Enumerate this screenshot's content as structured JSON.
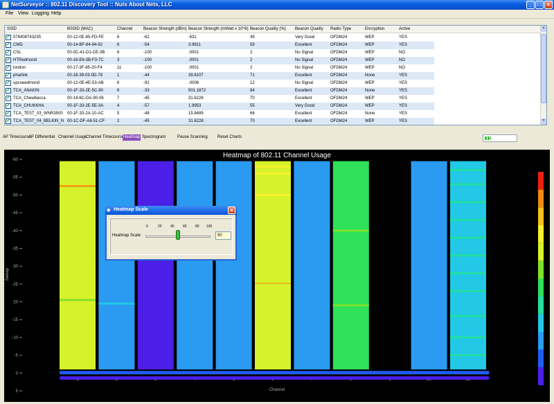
{
  "window": {
    "title": "NetSurveyor :: 802.11 Discovery Tool :: Nuts About Nets, LLC"
  },
  "menu": [
    "File",
    "View",
    "Logging",
    "Help"
  ],
  "grid": {
    "columns": [
      "SSID",
      "BSSID (MAC)",
      "Channel",
      "Beacon Strength (dBm)",
      "Beacon Strength (mWatt x 10^6)",
      "Beacon Quality (%)",
      "Beacon Quality",
      "Radio Type",
      "Encryption",
      "Active"
    ],
    "rows": [
      [
        "078408743235",
        "00-12-0E-85-FD-FE",
        "6",
        "-62",
        ".631",
        "49",
        "Very Good",
        "OFDM24",
        "WEP",
        "YES"
      ],
      [
        "CMD",
        "00-14-BF-84-94-92",
        "6",
        "-54",
        "3.9811",
        "59",
        "Excellent",
        "OFDM24",
        "WEP",
        "YES"
      ],
      [
        "CSL",
        "00-0C-41-D1-CE-3B",
        "6",
        "-100",
        ".0001",
        "2",
        "No Signal",
        "OFDM24",
        "WEP",
        "NO"
      ],
      [
        "HTRedmond",
        "00-16-E6-3B-F3-7C",
        "3",
        "-100",
        ".0001",
        "2",
        "No Signal",
        "OFDM24",
        "WEP",
        "NO"
      ],
      [
        "london",
        "00-17-3F-65-20-F4",
        "11",
        "-100",
        ".0001",
        "2",
        "No Signal",
        "OFDM24",
        "WEP",
        "NO"
      ],
      [
        "pharlink",
        "00-18-39-03-0D-78",
        "1",
        "-44",
        "39.8107",
        "71",
        "Excellent",
        "OFDM24",
        "None",
        "YES"
      ],
      [
        "upcoeedmond",
        "00-12-0E-4E-53-AB",
        "6",
        "-92",
        ".0006",
        "12",
        "No Signal",
        "OFDM24",
        "WEP",
        "YES"
      ],
      [
        "TCA_ANAKIN",
        "00-1F-33-2E-5C-90",
        "8",
        "-33",
        "501.1872",
        "84",
        "Excellent",
        "OFDM24",
        "None",
        "YES"
      ],
      [
        "TCA_Chewbacca",
        "00-14-6C-DA-90-06",
        "7",
        "-45",
        "31.6228",
        "70",
        "Excellent",
        "OFDM24",
        "WEP",
        "YES"
      ],
      [
        "TCA_CHUKKHA",
        "00-1F-33-2E-5E-3A",
        "4",
        "-57",
        "1.9953",
        "55",
        "Very Good",
        "OFDM24",
        "WEP",
        "YES"
      ],
      [
        "TCA_TEST_03_WNR3500",
        "00-1F-33-2A-10-AC",
        "5",
        "-48",
        "15.8489",
        "66",
        "Excellent",
        "OFDM24",
        "None",
        "YES"
      ],
      [
        "TCA_TEST_04_BELKIN_N",
        "00-1C-DF-A8-51-CF",
        "2",
        "-45",
        "31.6228",
        "70",
        "Excellent",
        "OFDM24",
        "WEP",
        "YES"
      ]
    ]
  },
  "toolbar": [
    "AP Timecourse",
    "AP Differential",
    "Channel Usage",
    "Channel Timecourse",
    "Heatmap",
    "Spectrogram",
    "Pause Scanning",
    "Reset Charts"
  ],
  "toolbar_active": "Heatmap",
  "progress": {
    "fraction": 0.2
  },
  "dialog": {
    "title": "Heatmap Scale",
    "label": "Heatmap Scale",
    "ticks": [
      "0",
      "20",
      "40",
      "60",
      "80",
      "100"
    ],
    "value": "50",
    "value_num": 50
  },
  "chart_data": {
    "type": "heatmap",
    "title": "Heatmap of 802.11 Channel Usage",
    "xlabel": "Channel",
    "ylabel": "Sweep",
    "x_categories": [
      "1",
      "2",
      "3",
      "4",
      "5",
      "6",
      "7",
      "8",
      "9",
      "10",
      "11"
    ],
    "y_ticks": [
      -60,
      -55,
      -50,
      -45,
      -40,
      -35,
      -30,
      -25,
      -20,
      -15,
      -10,
      -5,
      0,
      5
    ],
    "ylim": [
      5,
      -60
    ],
    "colorscale": [
      "#4b1fe6",
      "#1f5cf0",
      "#2a9bf0",
      "#22c8e6",
      "#21e0a0",
      "#2ee05a",
      "#7fe22a",
      "#d6f22a",
      "#f6f02a",
      "#f6c01a",
      "#f08a10",
      "#ee2010"
    ],
    "columns": [
      {
        "channel": "1",
        "base": "#d6f22a",
        "stripes": [
          {
            "y": -52.5,
            "color": "#f0a010"
          },
          {
            "y": -20.5,
            "color": "#7fe22a"
          }
        ]
      },
      {
        "channel": "2",
        "base": "#2a9bf0",
        "stripes": [
          {
            "y": -19.5,
            "color": "#22c8e6"
          }
        ]
      },
      {
        "channel": "3",
        "base": "#4b1fe6",
        "stripes": []
      },
      {
        "channel": "4",
        "base": "#2a9bf0",
        "stripes": []
      },
      {
        "channel": "5",
        "base": "#2a9bf0",
        "stripes": []
      },
      {
        "channel": "6",
        "base": "#d6f22a",
        "stripes": [
          {
            "y": -58,
            "color": "#f6f02a"
          },
          {
            "y": -56,
            "color": "#f6f02a"
          },
          {
            "y": -50,
            "color": "#f6f02a"
          },
          {
            "y": -25,
            "color": "#f08a10"
          }
        ]
      },
      {
        "channel": "7",
        "base": "#2a9bf0",
        "stripes": []
      },
      {
        "channel": "8",
        "base": "#2ee05a",
        "stripes": [
          {
            "y": -40,
            "color": "#7fe22a"
          },
          {
            "y": -19,
            "color": "#7fe22a"
          }
        ]
      },
      {
        "channel": "9",
        "base": "#000000",
        "stripes": []
      },
      {
        "channel": "10",
        "base": "#2a9bf0",
        "stripes": []
      },
      {
        "channel": "11",
        "base": "#22c8e6",
        "stripes": [
          {
            "y": -57,
            "color": "#21e0a0"
          },
          {
            "y": -53,
            "color": "#21e0a0"
          },
          {
            "y": -48,
            "color": "#21e0a0"
          },
          {
            "y": -43,
            "color": "#21e0a0"
          },
          {
            "y": -38,
            "color": "#21e0a0"
          },
          {
            "y": -33,
            "color": "#21e0a0"
          },
          {
            "y": -28,
            "color": "#21e0a0"
          },
          {
            "y": -23,
            "color": "#21e0a0"
          },
          {
            "y": -16,
            "color": "#21e0a0"
          },
          {
            "y": -10,
            "color": "#21e0a0"
          },
          {
            "y": -5,
            "color": "#21e0a0"
          }
        ]
      }
    ],
    "data_extent": [
      -59.5,
      -1
    ],
    "bottom_rows": [
      {
        "y": 0,
        "color": "#1f5cf0"
      },
      {
        "y": 1.5,
        "color": "#4b1fe6"
      }
    ]
  }
}
